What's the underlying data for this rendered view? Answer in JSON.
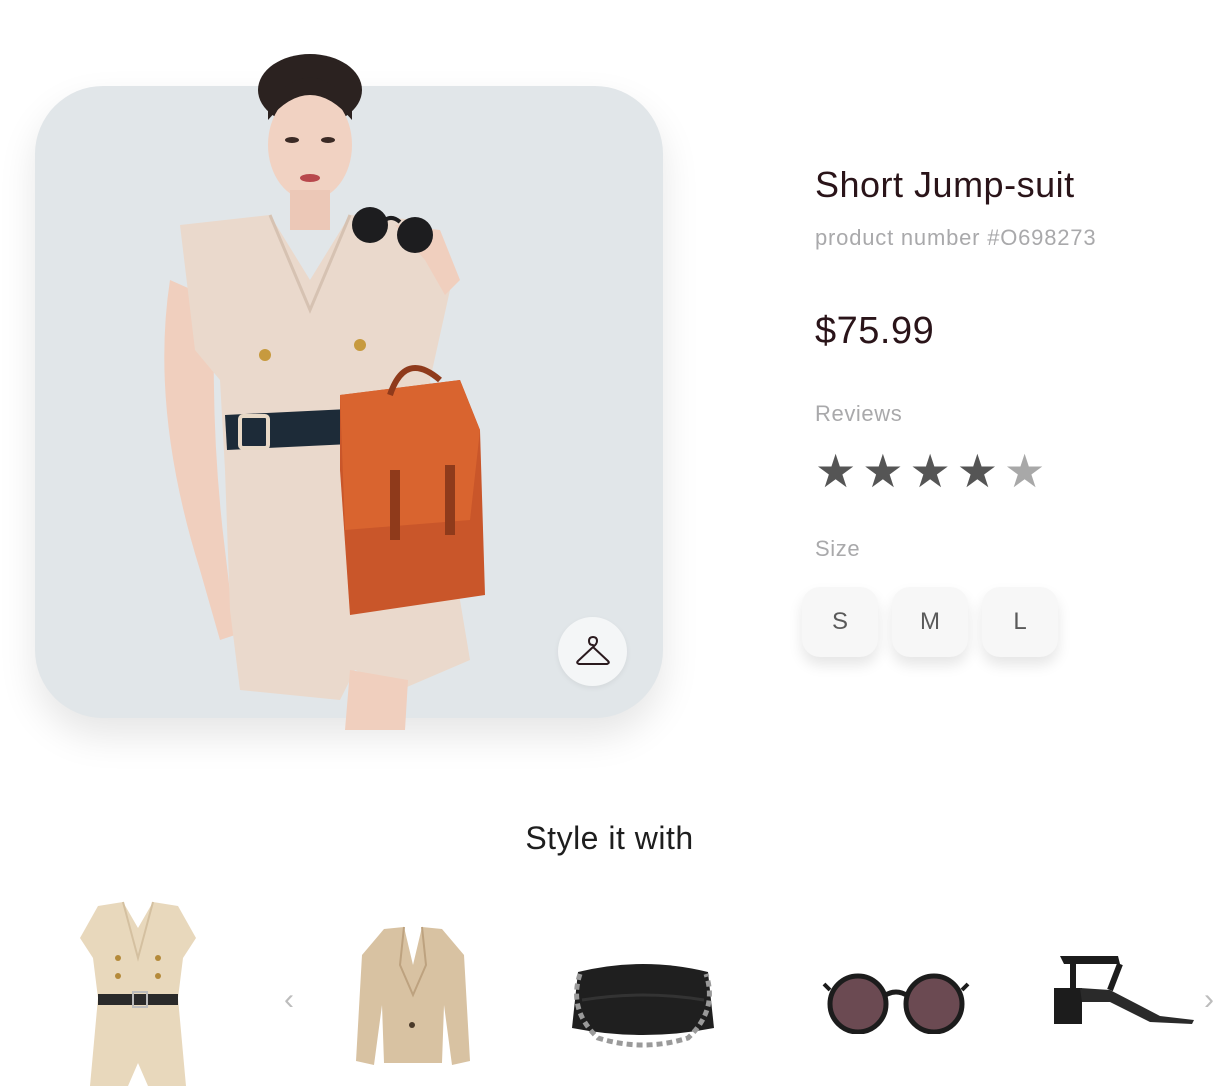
{
  "product": {
    "title": "Short Jump-suit",
    "product_number": "product number #O698273",
    "price": "$75.99",
    "reviews_label": "Reviews",
    "rating": 4.5,
    "rating_max": 5,
    "size_label": "Size",
    "sizes": [
      "S",
      "M",
      "L"
    ]
  },
  "hero": {
    "card_color": "#e1e6e9",
    "hanger_icon": "hanger-icon"
  },
  "style_it_with": {
    "title": "Style it with",
    "items": [
      "jumpsuit",
      "blazer",
      "clutch-bag",
      "sunglasses",
      "heeled-sandal"
    ],
    "prev_icon": "chevron-left-icon",
    "next_icon": "chevron-right-icon"
  },
  "colors": {
    "text": "#2a1419",
    "muted": "#a9a9ab",
    "bag": "#c9562a"
  }
}
